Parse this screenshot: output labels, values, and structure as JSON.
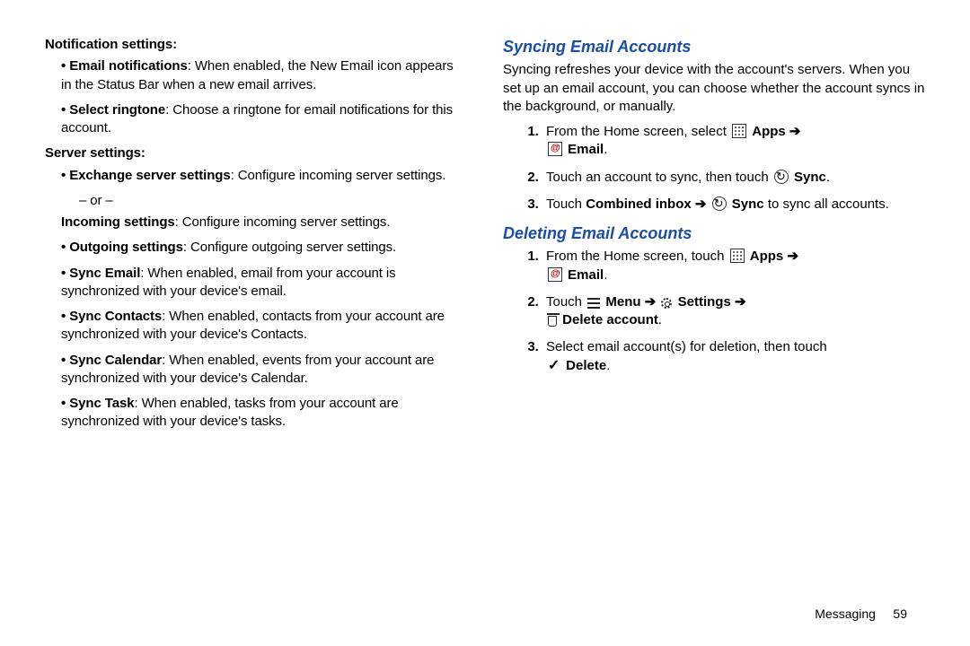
{
  "left": {
    "notification_heading": "Notification settings:",
    "notif_items": [
      {
        "b": "Email notifications",
        "t": ": When enabled, the New Email icon appears in the Status Bar when a new email arrives."
      },
      {
        "b": "Select ringtone",
        "t": ": Choose a ringtone for email notifications for this account."
      }
    ],
    "server_heading": "Server settings:",
    "server_item1_b": "Exchange server settings",
    "server_item1_t": ": Configure incoming server settings.",
    "or_text": "– or –",
    "incoming_b": "Incoming settings",
    "incoming_t": ": Configure incoming server settings.",
    "rest_items": [
      {
        "b": "Outgoing settings",
        "t": ": Configure outgoing server settings."
      },
      {
        "b": "Sync Email",
        "t": ": When enabled, email from your account is synchronized with your device's email."
      },
      {
        "b": "Sync Contacts",
        "t": ": When enabled, contacts from your account are synchronized with your device's Contacts."
      },
      {
        "b": "Sync Calendar",
        "t": ": When enabled, events from your account are synchronized with your device's Calendar."
      },
      {
        "b": "Sync Task",
        "t": ": When enabled, tasks from your account are synchronized with your device's tasks."
      }
    ]
  },
  "right": {
    "s1_title": "Syncing Email Accounts",
    "s1_intro": "Syncing refreshes your device with the account's servers. When you set up an email account, you can choose whether the account syncs in the background, or manually.",
    "s1_step1_pre": "From the Home screen, select ",
    "apps_label": "Apps",
    "email_label": "Email",
    "s1_step2_pre": "Touch an account to sync, then touch ",
    "sync_label": "Sync",
    "s1_step3_pre": "Touch ",
    "combined_inbox": "Combined inbox",
    "s1_step3_post": " to sync all accounts.",
    "s2_title": "Deleting Email Accounts",
    "s2_step1_pre": "From the Home screen, touch ",
    "s2_step2_pre": "Touch ",
    "menu_label": "Menu",
    "settings_label": "Settings",
    "delete_account_label": "Delete account",
    "s2_step3_pre": "Select email account(s) for deletion, then touch ",
    "delete_label": "Delete",
    "arrow": "➔",
    "period": "."
  },
  "footer": {
    "section": "Messaging",
    "page": "59"
  }
}
